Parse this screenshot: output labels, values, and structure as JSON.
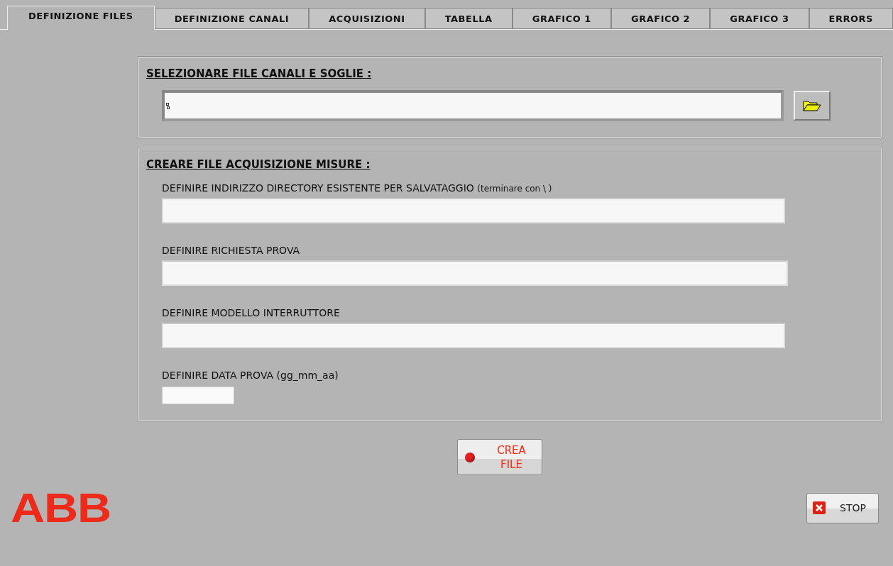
{
  "tabs": [
    {
      "label": "DEFINIZIONE FILES",
      "selected": true
    },
    {
      "label": "DEFINIZIONE CANALI",
      "selected": false
    },
    {
      "label": "ACQUISIZIONI",
      "selected": false
    },
    {
      "label": "TABELLA",
      "selected": false
    },
    {
      "label": "GRAFICO 1",
      "selected": false
    },
    {
      "label": "GRAFICO 2",
      "selected": false
    },
    {
      "label": "GRAFICO 3",
      "selected": false
    },
    {
      "label": "ERRORS",
      "selected": false
    }
  ],
  "file_section": {
    "title": "SELEZIONARE FILE CANALI E SOGLIE  :"
  },
  "create_section": {
    "title": "CREARE FILE ACQUISIZIONE MISURE :",
    "fields": [
      {
        "label": "DEFINIRE INDIRIZZO DIRECTORY ESISTENTE PER SALVATAGGIO",
        "note": "(terminare con \\ )",
        "kind": "wide"
      },
      {
        "label": "DEFINIRE RICHIESTA PROVA",
        "kind": "wide"
      },
      {
        "label": "DEFINIRE MODELLO INTERRUTTORE",
        "kind": "wide"
      },
      {
        "label": "DEFINIRE DATA PROVA (gg_mm_aa)",
        "kind": "short"
      }
    ]
  },
  "create_button": {
    "label_lines": [
      "CREA",
      "FILE"
    ],
    "led_on": true
  },
  "logo": "ABB",
  "stop_button": {
    "label": "STOP"
  }
}
